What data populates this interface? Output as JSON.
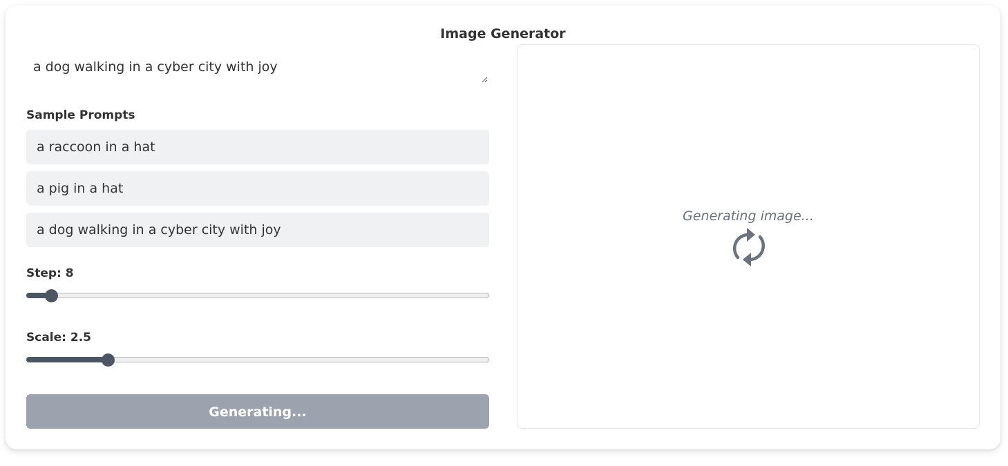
{
  "title": "Image Generator",
  "prompt": {
    "value": "a dog walking in a cyber city with joy"
  },
  "samples": {
    "label": "Sample Prompts",
    "items": [
      "a raccoon in a hat",
      "a pig in a hat",
      "a dog walking in a cyber city with joy"
    ]
  },
  "step": {
    "label": "Step: 8",
    "value": 8
  },
  "scale": {
    "label": "Scale: 2.5",
    "value": 2.5
  },
  "generate_button": {
    "label": "Generating..."
  },
  "preview": {
    "status": "Generating image...",
    "icon": "refresh-icon"
  },
  "colors": {
    "accent": "#4b5563",
    "button_disabled": "#9ca3af",
    "sample_bg": "#f0f1f3",
    "muted_text": "#6b7280"
  }
}
